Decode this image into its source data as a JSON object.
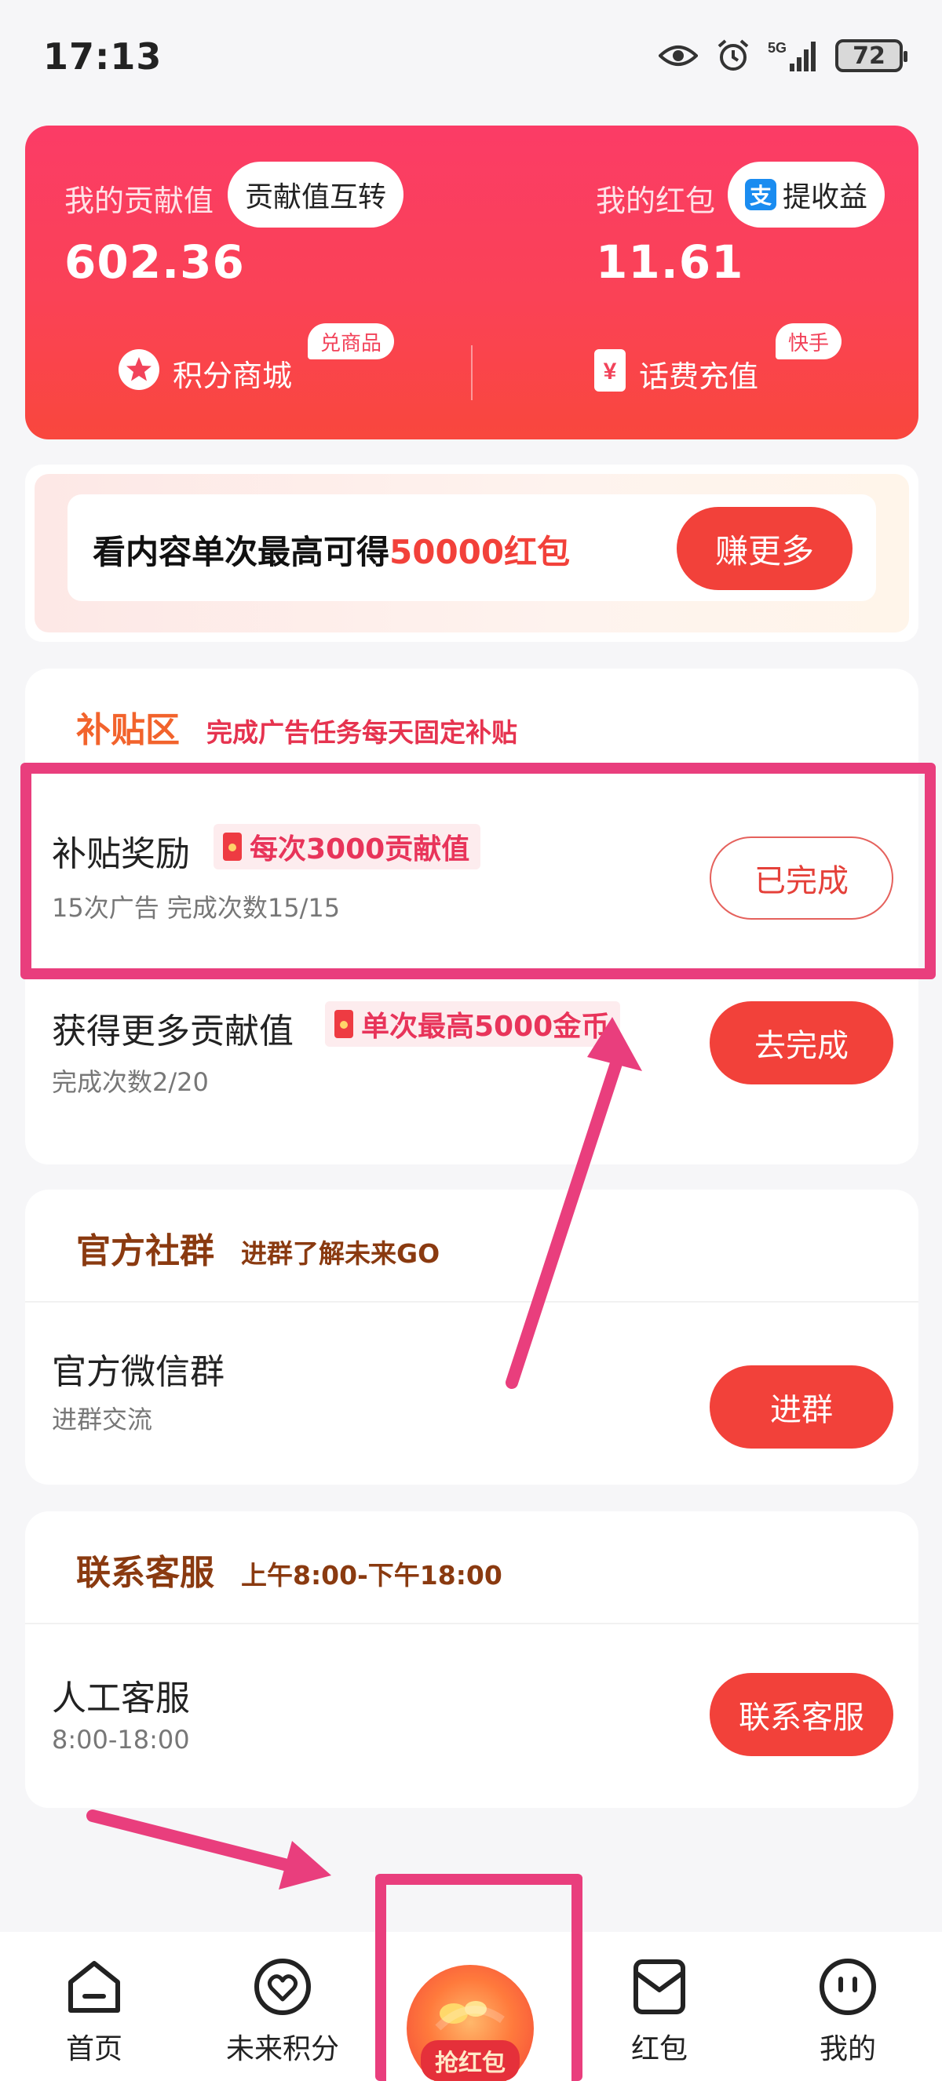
{
  "status_bar": {
    "time": "17:13",
    "network": "5G",
    "battery": "72"
  },
  "wallet": {
    "contribution_label": "我的贡献值",
    "contribution_transfer_button": "贡献值互转",
    "contribution_value": "602.36",
    "redpacket_label": "我的红包",
    "withdraw_button": "提收益",
    "redpacket_value": "11.61",
    "mall_label": "积分商城",
    "mall_badge": "兑商品",
    "recharge_label": "话费充值",
    "recharge_badge": "快手"
  },
  "promo": {
    "text_prefix": "看内容单次最高可得",
    "text_highlight": "50000红包",
    "button": "赚更多"
  },
  "subsidy_section": {
    "title": "补贴区",
    "subtitle": "完成广告任务每天固定补贴",
    "rows": [
      {
        "title": "补贴奖励",
        "tag": "每次3000贡献值",
        "sub": "15次广告  完成次数15/15",
        "button": "已完成"
      },
      {
        "title": "获得更多贡献值",
        "tag": "单次最高5000金币",
        "sub": "完成次数2/20",
        "button": "去完成"
      }
    ]
  },
  "community_section": {
    "title": "官方社群",
    "subtitle": "进群了解未来GO",
    "row": {
      "title": "官方微信群",
      "sub": "进群交流",
      "button": "进群"
    }
  },
  "service_section": {
    "title": "联系客服",
    "subtitle": "上午8:00-下午18:00",
    "row": {
      "title": "人工客服",
      "sub": "8:00-18:00",
      "button": "联系客服"
    }
  },
  "bottom_nav": {
    "home": "首页",
    "points": "未来积分",
    "grab_redpacket": "抢红包",
    "redpacket": "红包",
    "mine": "我的"
  },
  "colors": {
    "primary_red": "#f2413a",
    "card_gradient_top": "#fb3c66",
    "card_gradient_bottom": "#f9473d",
    "section_title_orange": "#f2632c",
    "section_title_brown": "#8a3a10",
    "annotation_pink": "#e93e7d"
  }
}
